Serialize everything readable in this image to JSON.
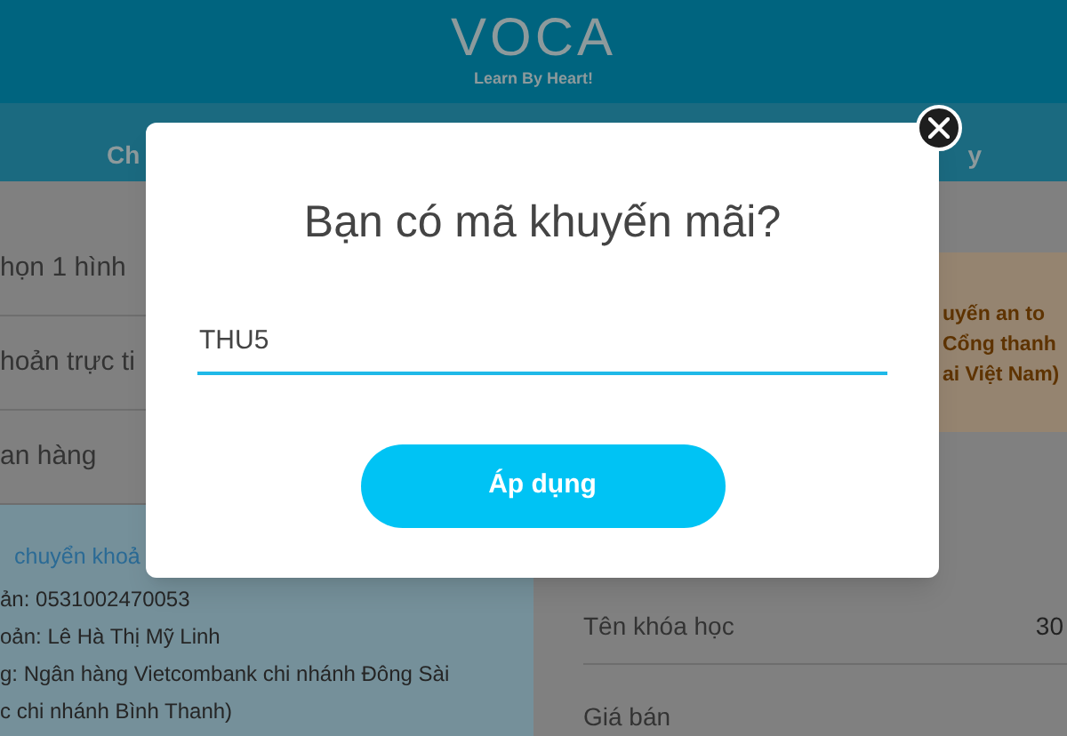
{
  "header": {
    "logo": "VOCA",
    "tagline": "Learn By Heart!"
  },
  "nav": {
    "items": [
      "Ch",
      "y"
    ]
  },
  "left": {
    "options": [
      "họn 1 hình",
      "hoản trực ti",
      "an hàng"
    ],
    "transfer": {
      "title": "chuyển khoả",
      "lines": [
        "ản: 0531002470053",
        "oản: Lê Hà Thị Mỹ Linh",
        "g: Ngân hàng Vietcombank chi nhánh Đông Sài",
        "c chi nhánh Bình Thanh)"
      ]
    }
  },
  "notice": {
    "lines": [
      "uyến an to",
      "Cổng thanh",
      "ai Việt Nam)"
    ]
  },
  "order": {
    "rows": [
      {
        "label": "Tên khóa học",
        "value": "30"
      },
      {
        "label": "Giá bán"
      }
    ]
  },
  "dialog": {
    "title": "Bạn có mã khuyến mãi?",
    "code": "THU5",
    "button": "Áp dụng"
  }
}
